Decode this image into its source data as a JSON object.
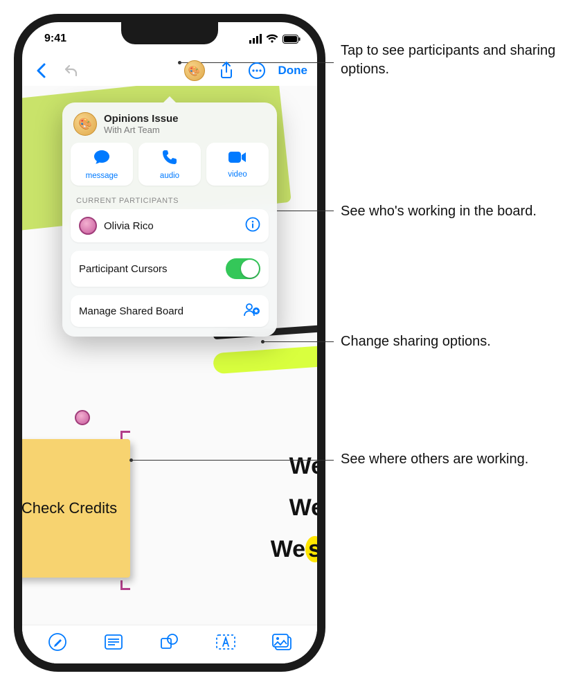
{
  "status": {
    "time": "9:41"
  },
  "nav": {
    "done": "Done"
  },
  "popover": {
    "title": "Opinions Issue",
    "subtitle": "With Art Team",
    "actions": {
      "message": "message",
      "audio": "audio",
      "video": "video"
    },
    "section_label": "CURRENT PARTICIPANTS",
    "participant_name": "Olivia Rico",
    "cursor_toggle_label": "Participant Cursors",
    "manage_label": "Manage Shared Board"
  },
  "sticky": {
    "text": "Check Credits"
  },
  "canvas": {
    "we1": "We",
    "we2": "We",
    "we3a": "We",
    "we3b": "s"
  },
  "callouts": {
    "collab": "Tap to see participants and sharing options.",
    "participants": "See who's working in the board.",
    "manage": "Change sharing options.",
    "cursor": "See where others are working."
  }
}
